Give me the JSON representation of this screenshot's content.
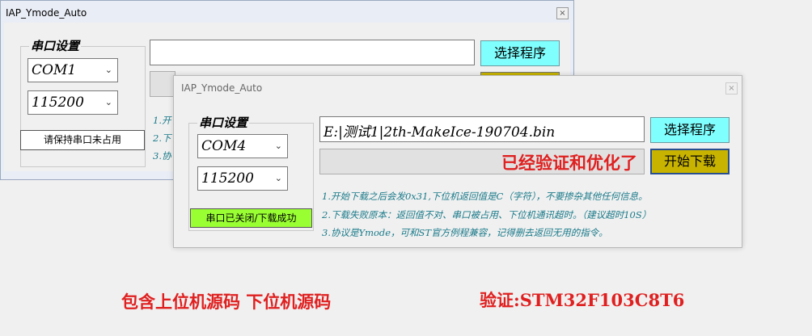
{
  "back_window": {
    "title": "IAP_Ymode_Auto",
    "close_glyph": "×",
    "serial_group_title": "串口设置",
    "port_value": "COM1",
    "baud_value": "115200",
    "status_label": "请保持串口未占用",
    "select_program_label": "选择程序",
    "info_fragments": [
      "1.开",
      "2.下",
      "3.协"
    ]
  },
  "front_window": {
    "title": "IAP_Ymode_Auto",
    "close_glyph": "×",
    "serial_group_title": "串口设置",
    "port_value": "COM4",
    "baud_value": "115200",
    "status_label": "串口已关闭/下载成功",
    "file_path": "E:|测试1|2th-MakeIce-190704.bin",
    "select_program_label": "选择程序",
    "start_download_label": "开始下载",
    "verified_text": "已经验证和优化了",
    "info_lines": [
      "1.开始下载之后会发0x31,下位机返回值是C（字符），不要掺杂其他任何信息。",
      "2.下载失败原本：返回值不对、串口被占用、下位机通讯超时。（建议超时10S）",
      "3.协议是Ymode，可和ST官方例程兼容，记得删去返回无用的指令。"
    ]
  },
  "captions": {
    "left": "包含上位机源码 下位机源码",
    "right": "验证:STM32F103C8T6"
  },
  "colors": {
    "cyan_button": "#80ffff",
    "olive_button": "#c8b400",
    "green_status": "#99ff33",
    "info_text": "#1a7a8a",
    "caption_red": "#e02020"
  }
}
